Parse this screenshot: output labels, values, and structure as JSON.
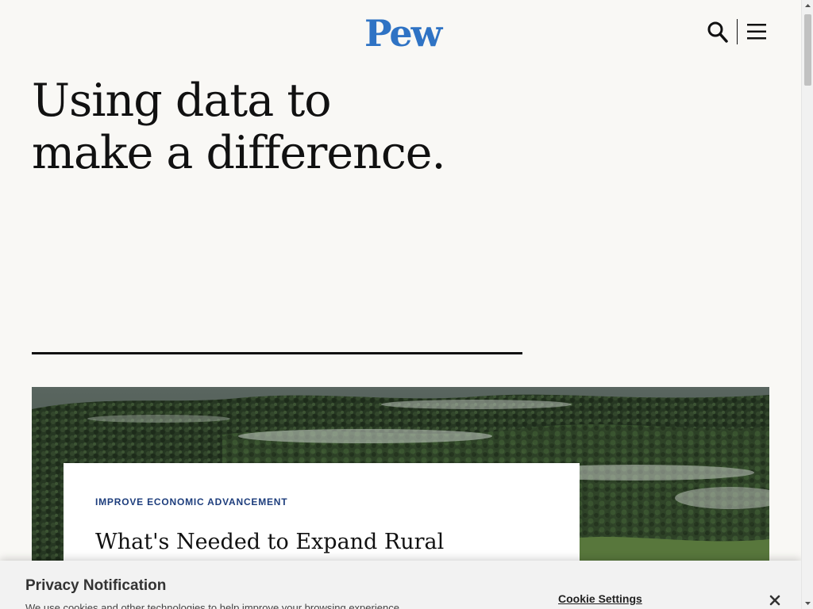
{
  "header": {
    "logo": "Pew",
    "search_icon": "search-icon",
    "menu_icon": "hamburger-menu-icon"
  },
  "hero": {
    "title_line1": "Using data to",
    "title_line2": "make a difference."
  },
  "feature": {
    "image": "forested-hills-with-mist",
    "kicker": "IMPROVE ECONOMIC ADVANCEMENT",
    "headline": "What's Needed to Expand Rural Homeownership"
  },
  "privacy": {
    "title": "Privacy Notification",
    "text": "We use cookies and other technologies to help improve your browsing experience",
    "cookie_settings": "Cookie Settings",
    "close_icon": "close-icon"
  },
  "colors": {
    "background": "#f9f8f5",
    "logo_blue": "#2f73c4",
    "kicker_navy": "#1d3d7c",
    "text": "#111111"
  }
}
